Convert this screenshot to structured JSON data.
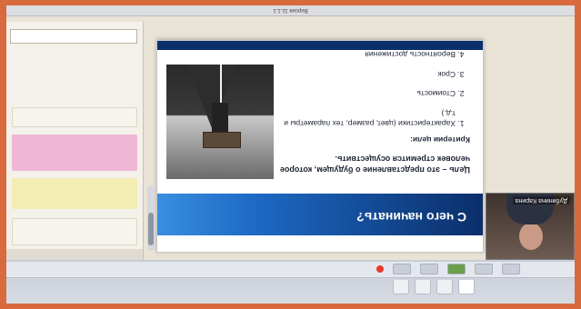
{
  "slide": {
    "title": "С чего начинать?",
    "lead": "Цель – это представление о будущем, которое человек стремится осуществить.",
    "criteria_heading": "Критерии цели:",
    "criteria": [
      "Характеристики (цвет, размер, тех параметры и т.д.)",
      "Стоимость",
      "Срок",
      "Вероятность достижения"
    ]
  },
  "webcam": {
    "caption": "Дубинина Карина"
  },
  "status": {
    "text": "Версия 11.1.1"
  },
  "colors": {
    "frame_border": "#d86a3e",
    "banner": "#1d69c4",
    "record": "#e53b2c",
    "chat_yellow": "#f3ecb3",
    "chat_pink": "#efb6d6"
  }
}
